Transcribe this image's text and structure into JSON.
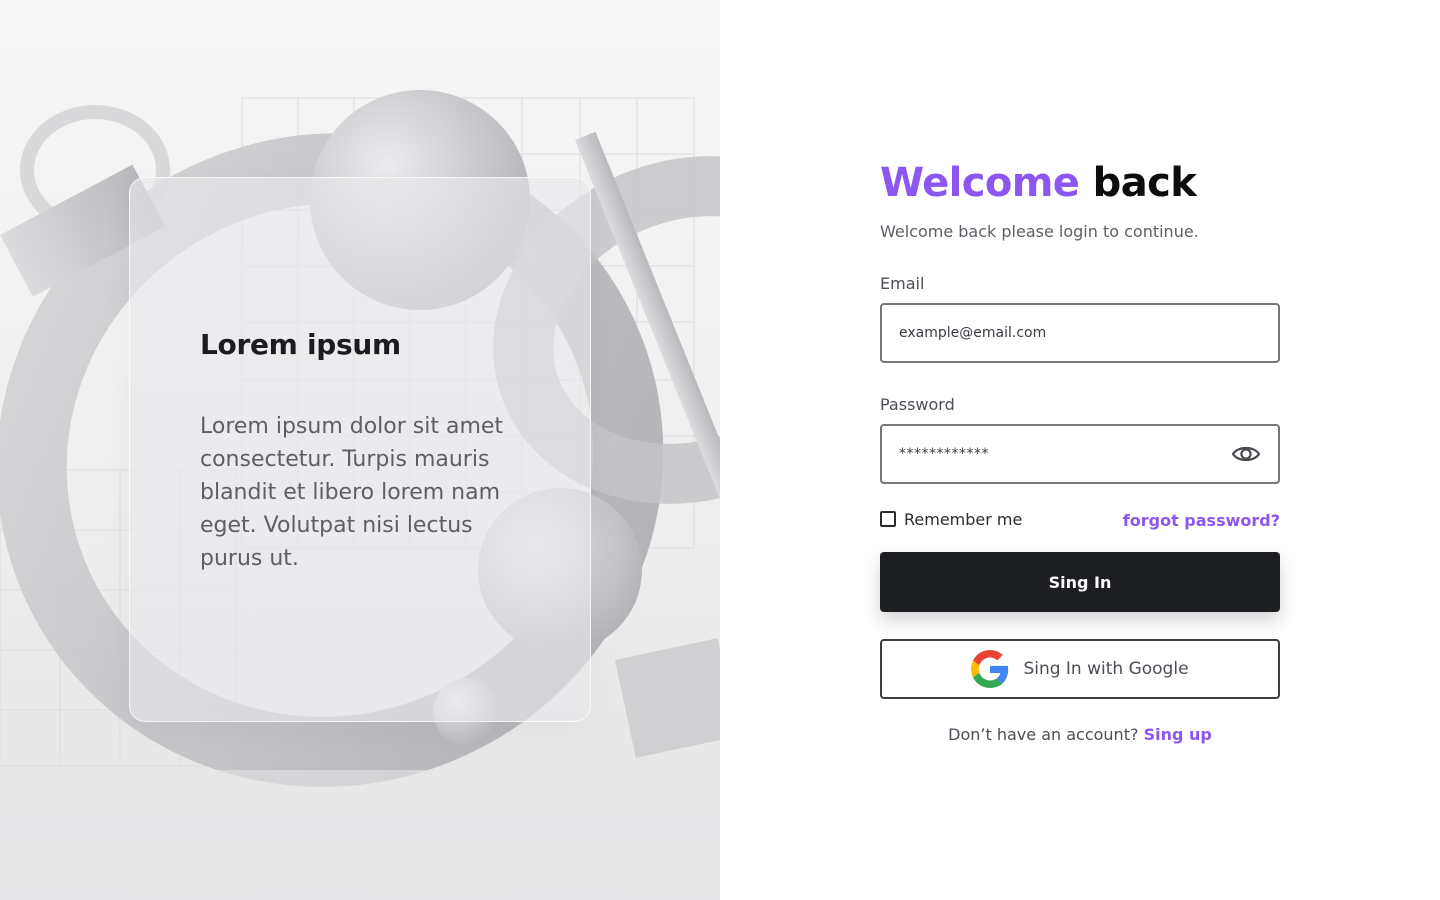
{
  "hero": {
    "card_title": "Lorem ipsum",
    "card_body": "Lorem ipsum dolor sit amet consectetur. Turpis mauris blandit et libero lorem nam eget. Volutpat nisi lectus purus ut."
  },
  "login": {
    "title_accent": "Welcome",
    "title_rest": "back",
    "subtitle": "Welcome back please login to continue.",
    "email_label": "Email",
    "email_placeholder": "example@email.com",
    "password_label": "Password",
    "password_value": "************",
    "remember_label": "Remember me",
    "forgot_label": "forgot password?",
    "signin_label": "Sing In",
    "google_label": "Sing In  with Google",
    "no_account_text": "Don’t have an account?",
    "signup_label": "Sing up"
  },
  "icons": {
    "eye": "eye-icon",
    "google": "google-logo-icon"
  },
  "colors": {
    "accent": "#8b57f0",
    "primary_button": "#1d1e22",
    "text_dark": "#0d0d10",
    "text_muted": "#5e5e66"
  }
}
